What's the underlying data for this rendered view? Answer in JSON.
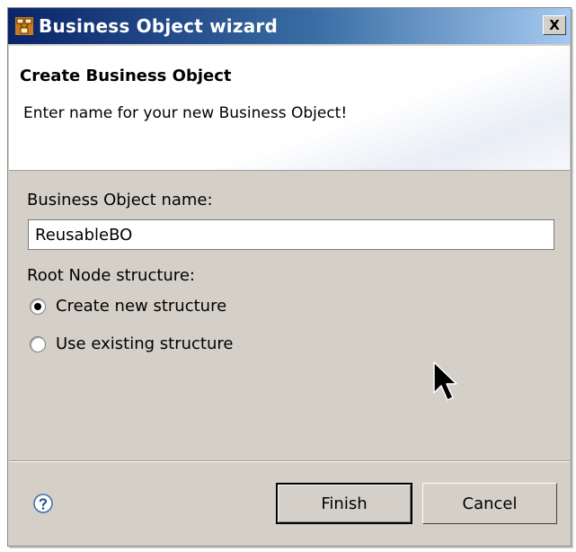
{
  "window": {
    "title": "Business Object wizard",
    "close_label": "X",
    "colors": {
      "titlebar_start": "#0a246a",
      "titlebar_end": "#a6caf0",
      "face": "#d4d0c8"
    }
  },
  "header": {
    "title": "Create Business Object",
    "message": "Enter name for your new Business Object!"
  },
  "form": {
    "name_label": "Business Object name:",
    "name_value": "ReusableBO",
    "root_node_label": "Root Node structure:",
    "options": [
      {
        "label": "Create new structure",
        "selected": true
      },
      {
        "label": "Use existing structure",
        "selected": false
      }
    ]
  },
  "footer": {
    "help_icon": "question-mark-circle-icon",
    "finish_label": "Finish",
    "cancel_label": "Cancel"
  }
}
